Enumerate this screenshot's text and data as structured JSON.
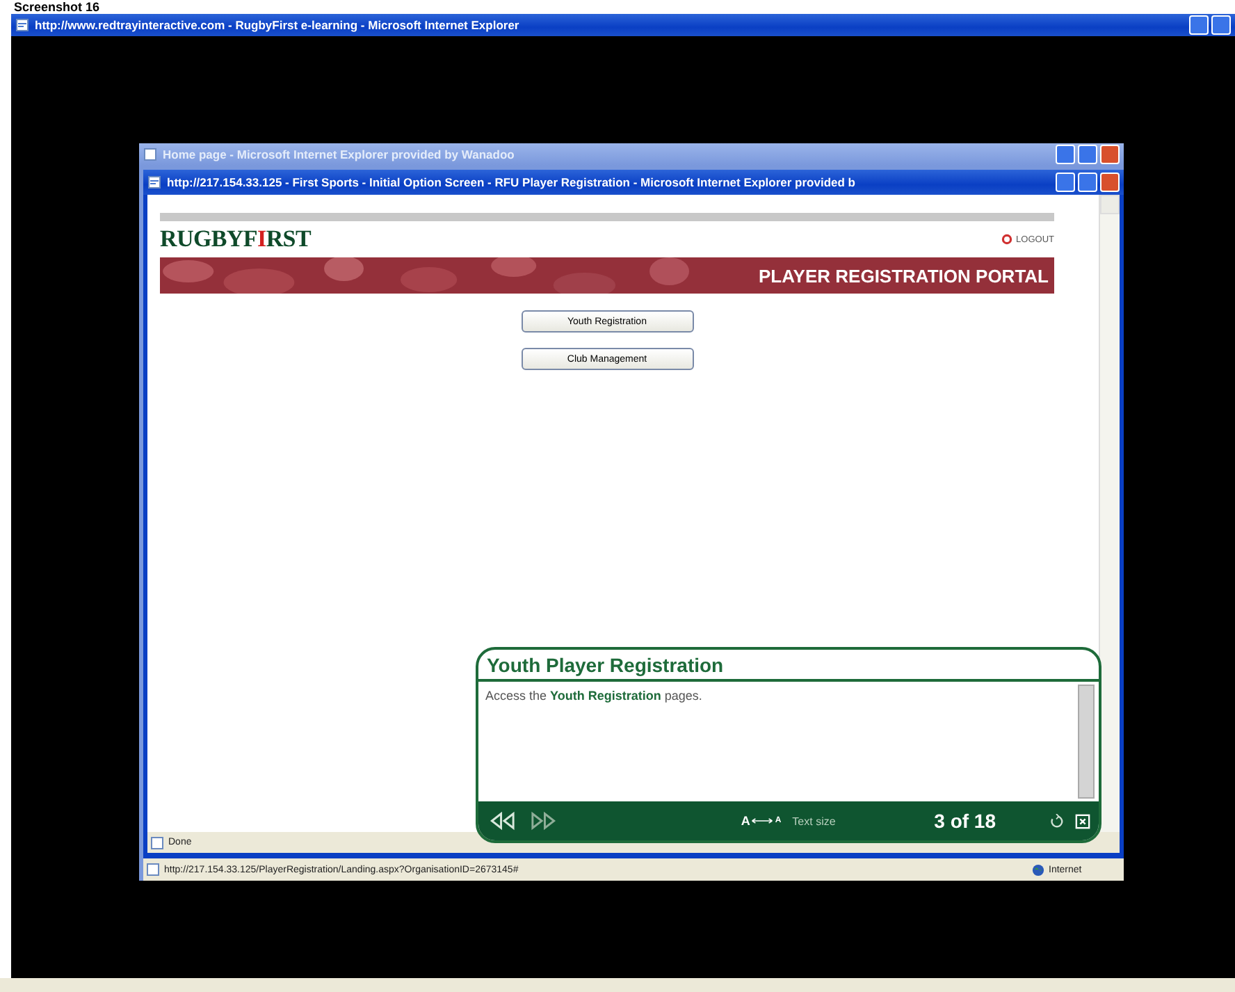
{
  "caption": "Screenshot 16",
  "outer_window": {
    "title": "http://www.redtrayinteractive.com - RugbyFirst e-learning - Microsoft Internet Explorer"
  },
  "back_window": {
    "title": "Home page - Microsoft Internet Explorer provided by Wanadoo"
  },
  "front_window": {
    "title": "http://217.154.33.125 - First Sports - Initial Option Screen - RFU Player Registration - Microsoft Internet Explorer provided b"
  },
  "page": {
    "logo": {
      "before": "RUGBYF",
      "accent": "I",
      "after": "RST"
    },
    "logout": "LOGOUT",
    "banner_title": "PLAYER REGISTRATION PORTAL",
    "buttons": [
      "Youth Registration",
      "Club Management"
    ]
  },
  "status_done": "Done",
  "status_url": {
    "text": "http://217.154.33.125/PlayerRegistration/Landing.aspx?OrganisationID=2673145#",
    "zone": "Internet"
  },
  "tutorial": {
    "title": "Youth Player Registration",
    "body": "Access the **Youth Registration** pages.",
    "text_size": {
      "big": "A",
      "small": "A",
      "label": "Text size"
    },
    "counter": "3 of 18"
  }
}
